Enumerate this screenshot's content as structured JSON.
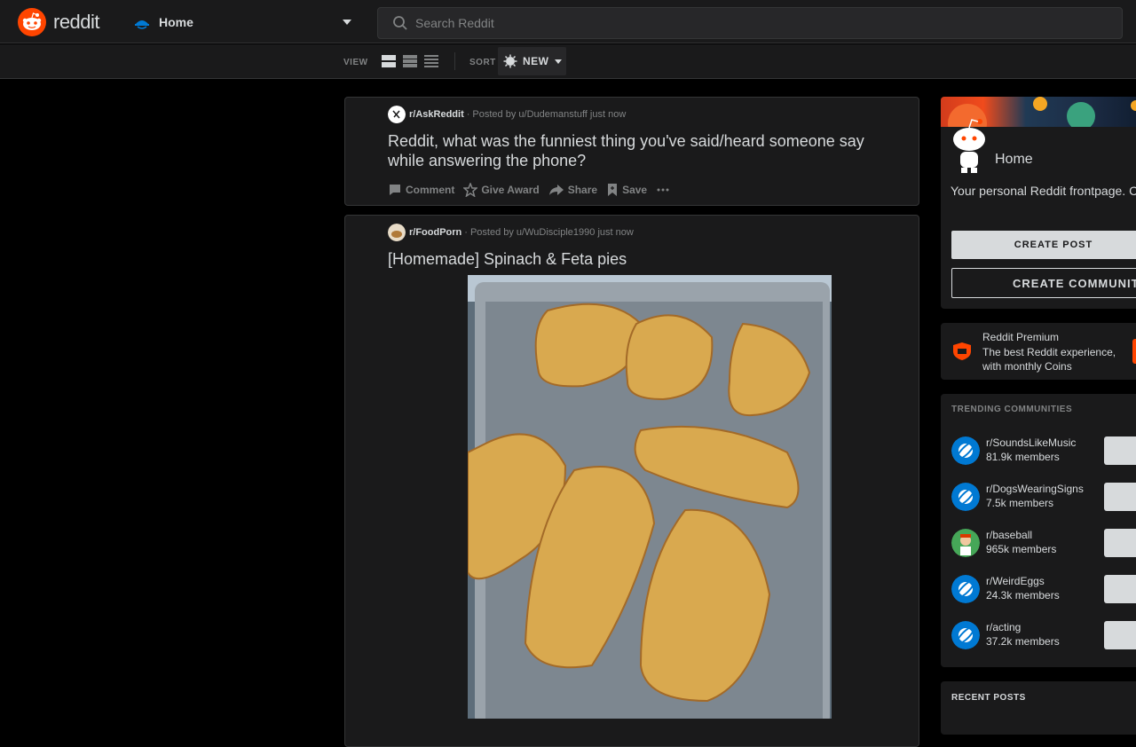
{
  "header": {
    "logo_text": "reddit",
    "home_label": "Home",
    "search_placeholder": "Search Reddit"
  },
  "subbar": {
    "view_label": "VIEW",
    "sort_label": "SORT",
    "sort_value": "NEW"
  },
  "posts": [
    {
      "subreddit": "r/AskReddit",
      "posted_by": "Posted by u/Dudemanstuff just now",
      "title": "Reddit, what was the funniest thing you've said/heard someone say while answering the phone?",
      "actions": [
        "Comment",
        "Give Award",
        "Share",
        "Save"
      ]
    },
    {
      "subreddit": "r/FoodPorn",
      "posted_by": "Posted by u/WuDisciple1990 just now",
      "title": "[Homemade] Spinach & Feta pies"
    }
  ],
  "sidebar": {
    "home_title": "Home",
    "home_desc": "Your personal Reddit frontpage. Come here to check in with your favorite communities.",
    "create_post": "CREATE POST",
    "create_community": "CREATE COMMUNITY",
    "premium_title": "Reddit Premium",
    "premium_desc": "The best Reddit experience, with monthly Coins",
    "trending_title": "TRENDING COMMUNITIES",
    "communities": [
      {
        "name": "r/SoundsLikeMusic",
        "members": "81.9k members"
      },
      {
        "name": "r/DogsWearingSigns",
        "members": "7.5k members"
      },
      {
        "name": "r/baseball",
        "members": "965k members"
      },
      {
        "name": "r/WeirdEggs",
        "members": "24.3k members"
      },
      {
        "name": "r/acting",
        "members": "37.2k members"
      }
    ],
    "recent_title": "RECENT POSTS"
  },
  "colors": {
    "brand": "#ff4500",
    "bg": "#000000",
    "card": "#1a1a1b",
    "text": "#d7dadc",
    "muted": "#818384"
  }
}
